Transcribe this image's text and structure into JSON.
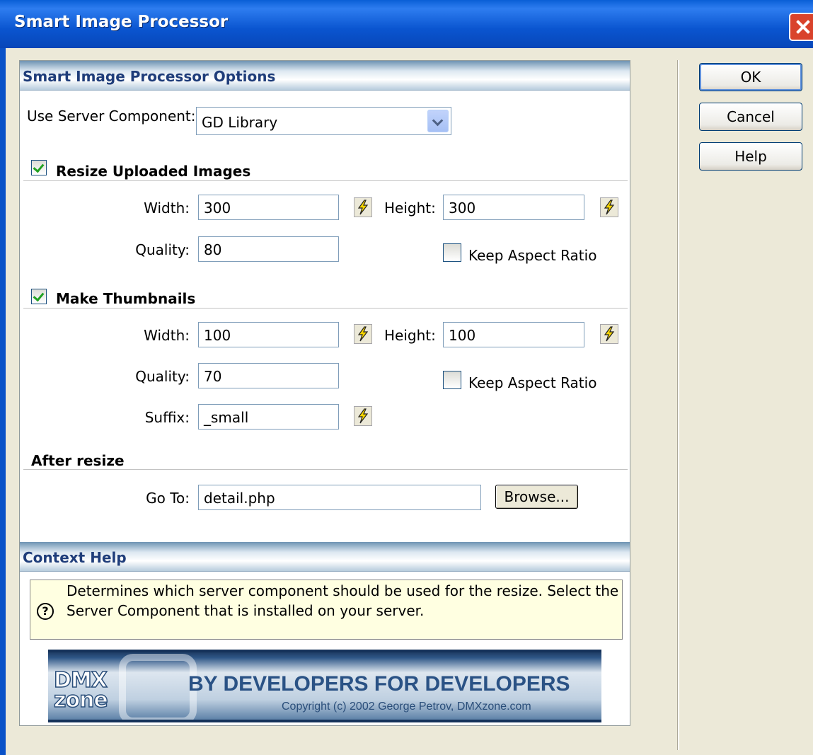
{
  "window": {
    "title": "Smart Image Processor"
  },
  "options": {
    "header": "Smart Image Processor Options",
    "server_component": {
      "label": "Use Server Component:",
      "value": "GD Library"
    },
    "resize": {
      "checkbox_label": "Resize Uploaded Images",
      "checked": true,
      "width_label": "Width:",
      "width_value": "300",
      "height_label": "Height:",
      "height_value": "300",
      "quality_label": "Quality:",
      "quality_value": "80",
      "keep_aspect_label": "Keep Aspect Ratio",
      "keep_aspect_checked": false
    },
    "thumbnails": {
      "checkbox_label": "Make Thumbnails",
      "checked": true,
      "width_label": "Width:",
      "width_value": "100",
      "height_label": "Height:",
      "height_value": "100",
      "quality_label": "Quality:",
      "quality_value": "70",
      "keep_aspect_label": "Keep Aspect Ratio",
      "keep_aspect_checked": false,
      "suffix_label": "Suffix:",
      "suffix_value": "_small"
    },
    "after_resize": {
      "header": "After resize",
      "goto_label": "Go To:",
      "goto_value": "detail.php",
      "browse_label": "Browse..."
    }
  },
  "context_help": {
    "header": "Context Help",
    "line1": "Determines which server component should be used for the resize. Select the",
    "line2": "Server Component that is installed on your server."
  },
  "banner": {
    "logo_line1": "DMX",
    "logo_line2": "zone",
    "slogan": "BY DEVELOPERS FOR DEVELOPERS",
    "copyright": "Copyright (c) 2002 George Petrov, DMXzone.com"
  },
  "buttons": {
    "ok": "OK",
    "cancel": "Cancel",
    "help": "Help"
  },
  "icons": {
    "close": "close-icon",
    "dropdown": "chevron-down-icon",
    "bolt": "lightning-bolt-icon",
    "help": "question-icon"
  },
  "colors": {
    "titlebar": "#0A55D0",
    "dialog_bg": "#ECE9D8",
    "section_text": "#1F3D7A",
    "help_bg": "#FFFFE1"
  }
}
